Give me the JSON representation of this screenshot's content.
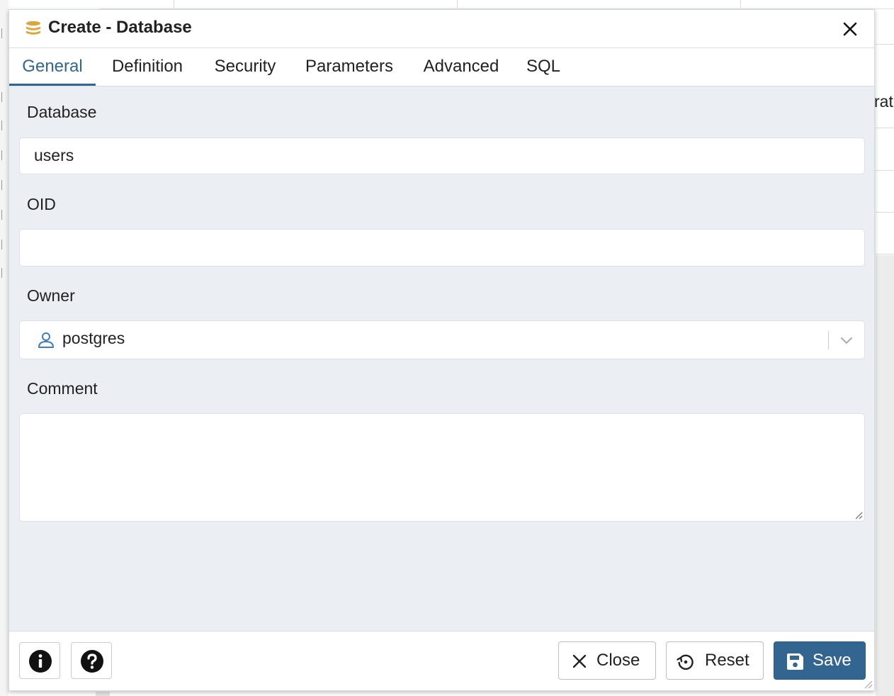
{
  "dialog": {
    "title": "Create - Database",
    "icon": "database-icon"
  },
  "tabs": [
    {
      "label": "General",
      "active": true
    },
    {
      "label": "Definition",
      "active": false
    },
    {
      "label": "Security",
      "active": false
    },
    {
      "label": "Parameters",
      "active": false
    },
    {
      "label": "Advanced",
      "active": false
    },
    {
      "label": "SQL",
      "active": false
    }
  ],
  "form": {
    "database_label": "Database",
    "database_value": "users",
    "oid_label": "OID",
    "oid_value": "",
    "owner_label": "Owner",
    "owner_value": "postgres",
    "comment_label": "Comment",
    "comment_value": ""
  },
  "footer": {
    "info_icon": "info-icon",
    "help_icon": "help-icon",
    "close_label": "Close",
    "reset_label": "Reset",
    "save_label": "Save"
  },
  "background": {
    "partial_text": "rat"
  },
  "colors": {
    "accent": "#326690",
    "panel": "#ebeef3",
    "database_icon": "#d9a73b"
  }
}
